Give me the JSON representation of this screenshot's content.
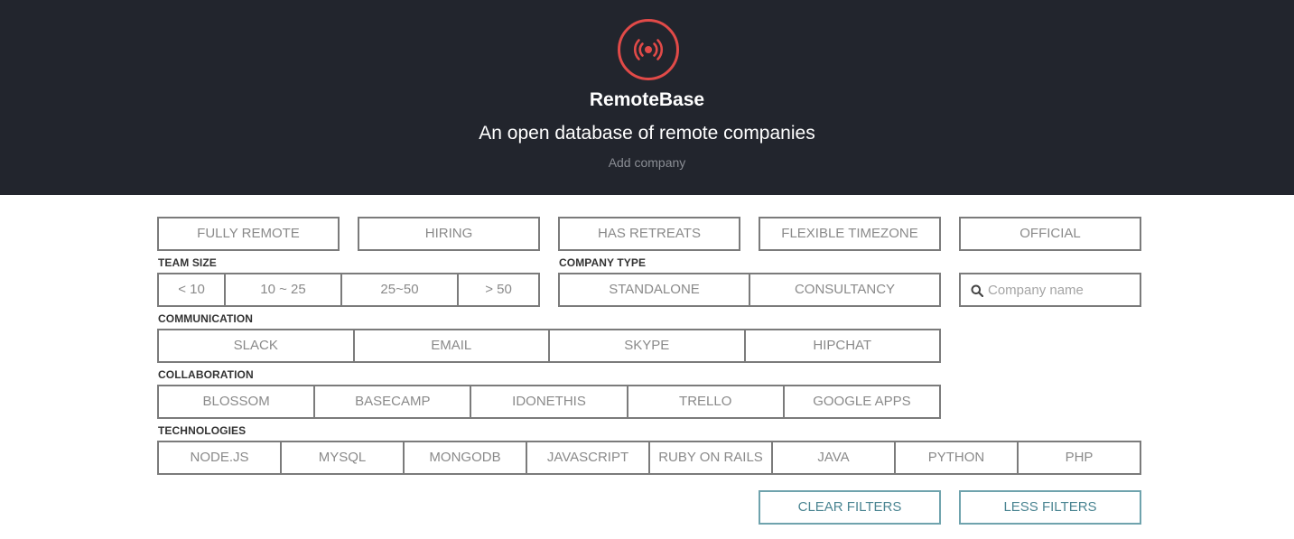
{
  "header": {
    "brand": "RemoteBase",
    "tagline": "An open database of remote companies",
    "add_company": "Add company",
    "logo_icon": "broadcast-icon",
    "logo_color": "#e14a48",
    "background": "#22252d"
  },
  "filters": {
    "top": [
      "FULLY REMOTE",
      "HIRING",
      "HAS RETREATS",
      "FLEXIBLE TIMEZONE",
      "OFFICIAL"
    ],
    "team_size": {
      "label": "TEAM SIZE",
      "options": [
        "< 10",
        "10 ~ 25",
        "25~50",
        "> 50"
      ]
    },
    "company_type": {
      "label": "COMPANY TYPE",
      "options": [
        "STANDALONE",
        "CONSULTANCY"
      ]
    },
    "search": {
      "placeholder": "Company name",
      "value": "",
      "icon": "search-icon"
    },
    "communication": {
      "label": "COMMUNICATION",
      "options": [
        "SLACK",
        "EMAIL",
        "SKYPE",
        "HIPCHAT"
      ]
    },
    "collaboration": {
      "label": "COLLABORATION",
      "options": [
        "BLOSSOM",
        "BASECAMP",
        "IDONETHIS",
        "TRELLO",
        "GOOGLE APPS"
      ]
    },
    "technologies": {
      "label": "TECHNOLOGIES",
      "options": [
        "NODE.JS",
        "MYSQL",
        "MONGODB",
        "JAVASCRIPT",
        "RUBY ON RAILS",
        "JAVA",
        "PYTHON",
        "PHP"
      ]
    }
  },
  "actions": {
    "clear": "CLEAR FILTERS",
    "less": "LESS FILTERS",
    "accent": "#4b8592"
  }
}
